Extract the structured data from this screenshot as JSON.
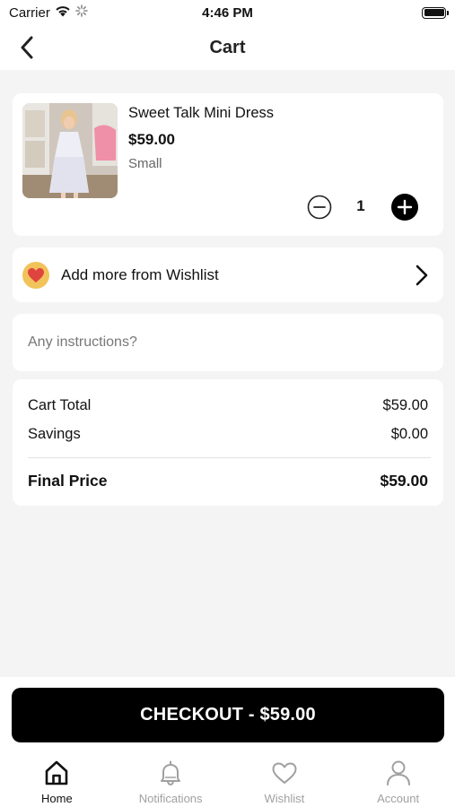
{
  "status_bar": {
    "carrier": "Carrier",
    "time": "4:46 PM",
    "wifi_icon": "wifi-icon",
    "activity_icon": "loading-spinner-icon",
    "battery_icon": "battery-icon",
    "battery_level": 1.0
  },
  "nav": {
    "title": "Cart",
    "back_icon": "chevron-left-icon"
  },
  "cart_item": {
    "name": "Sweet Talk Mini Dress",
    "price": "$59.00",
    "size": "Small",
    "quantity": "1",
    "minus_icon": "minus-circle-icon",
    "plus_icon": "plus-circle-filled-icon"
  },
  "wishlist": {
    "label": "Add more from Wishlist",
    "icon": "heart-icon",
    "arrow_icon": "chevron-right-icon"
  },
  "instructions": {
    "placeholder": "Any instructions?",
    "value": ""
  },
  "summary": {
    "cart_total_label": "Cart Total",
    "cart_total_value": "$59.00",
    "savings_label": "Savings",
    "savings_value": "$0.00",
    "final_price_label": "Final Price",
    "final_price_value": "$59.00"
  },
  "checkout": {
    "label": "CHECKOUT - $59.00"
  },
  "tabs": [
    {
      "label": "Home",
      "icon": "home-icon",
      "active": true
    },
    {
      "label": "Notifications",
      "icon": "bell-icon",
      "active": false
    },
    {
      "label": "Wishlist",
      "icon": "heart-outline-icon",
      "active": false
    },
    {
      "label": "Account",
      "icon": "user-icon",
      "active": false
    }
  ],
  "colors": {
    "background": "#f4f4f4",
    "card": "#ffffff",
    "primary": "#000000",
    "inactive_tab": "#a0a0a0",
    "heart_badge": "#f1c35a",
    "heart": "#e0443f"
  }
}
